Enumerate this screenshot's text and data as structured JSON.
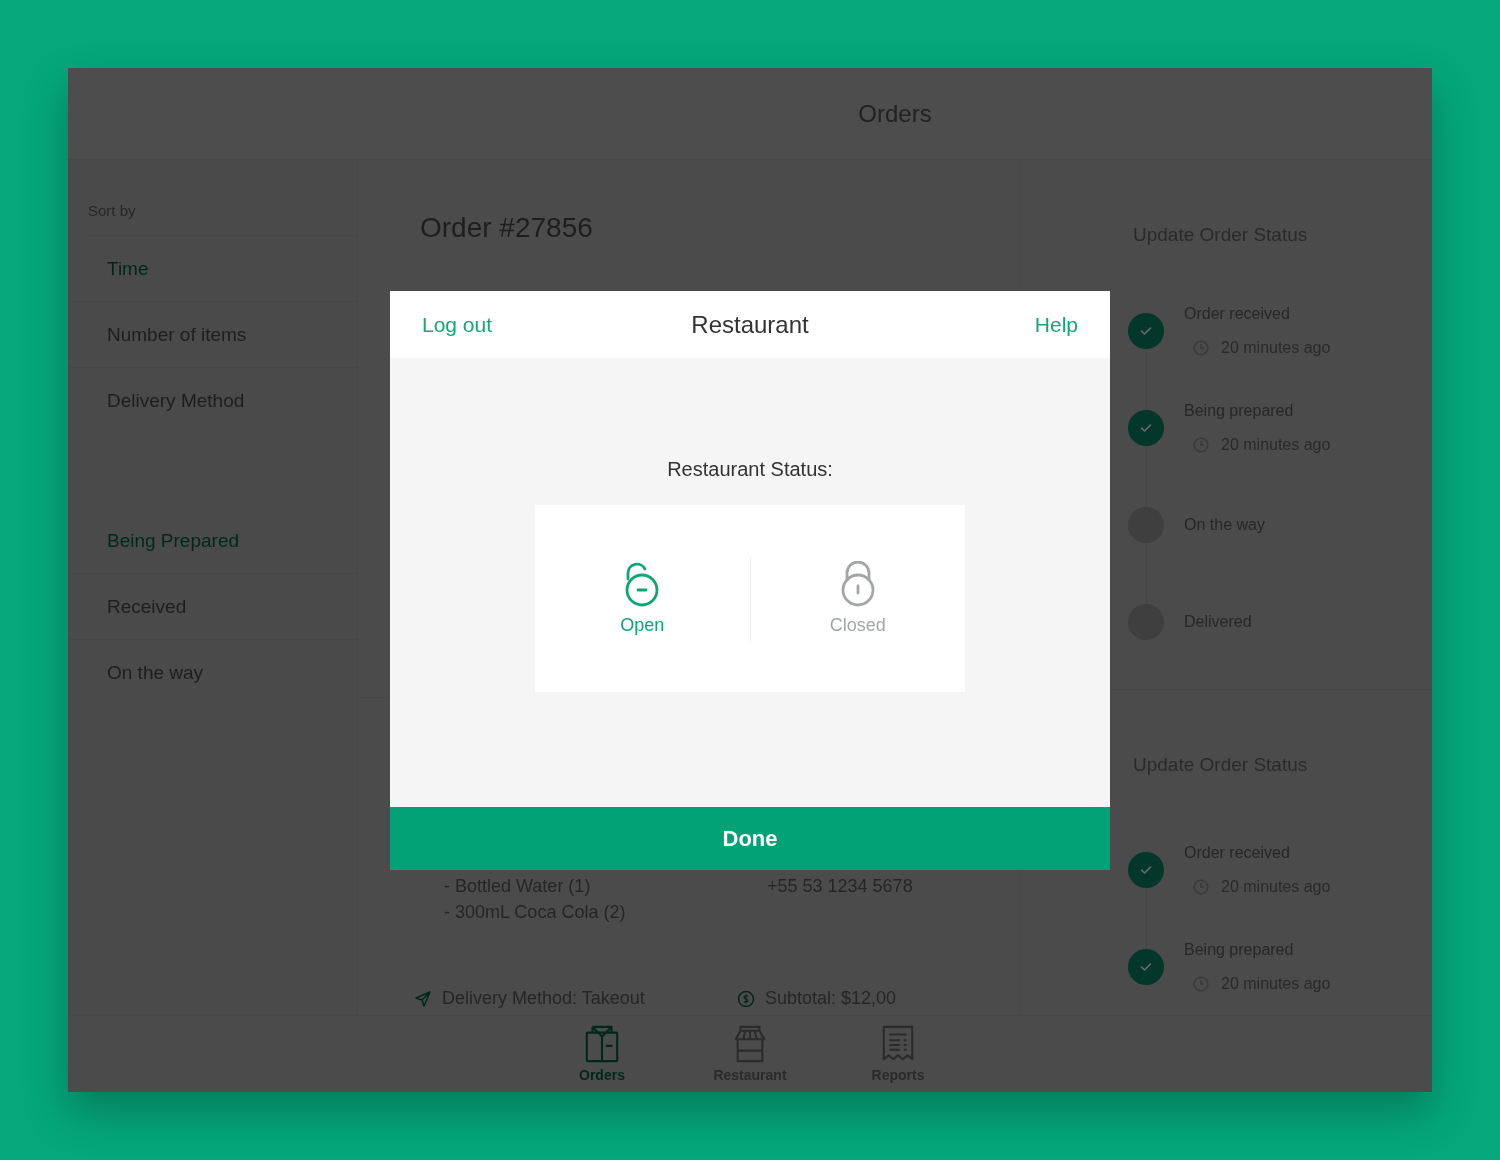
{
  "header": {
    "title": "Orders"
  },
  "sidebar": {
    "sort_label": "Sort by",
    "sort_options": [
      {
        "label": "Time",
        "selected": true
      },
      {
        "label": "Number of items",
        "selected": false
      },
      {
        "label": "Delivery Method",
        "selected": false
      }
    ],
    "status_filters": [
      {
        "label": "Being Prepared",
        "selected": true
      },
      {
        "label": "Received",
        "selected": false
      },
      {
        "label": "On the way",
        "selected": false
      }
    ]
  },
  "orders": [
    {
      "number": "Order #27856"
    },
    {
      "items": [
        "- Bottled Water (1)",
        "- 300mL Coca Cola (2)"
      ],
      "phone": "+55 53 1234 5678",
      "delivery_method": "Delivery Method: Takeout",
      "subtotal": "Subtotal: $12,00"
    }
  ],
  "status_panels": [
    {
      "title": "Update Order Status",
      "steps": [
        {
          "label": "Order received",
          "time": "20 minutes ago",
          "done": true
        },
        {
          "label": "Being prepared",
          "time": "20 minutes ago",
          "done": true
        },
        {
          "label": "On the way",
          "done": false
        },
        {
          "label": "Delivered",
          "done": false
        }
      ]
    },
    {
      "title": "Update Order Status",
      "steps": [
        {
          "label": "Order received",
          "time": "20 minutes ago",
          "done": true
        },
        {
          "label": "Being prepared",
          "time": "20 minutes ago",
          "done": true
        }
      ]
    }
  ],
  "tab_bar": [
    {
      "label": "Orders",
      "kind": "orders",
      "selected": true
    },
    {
      "label": "Restaurant",
      "kind": "restaurant",
      "selected": false
    },
    {
      "label": "Reports",
      "kind": "reports",
      "selected": false
    }
  ],
  "modal": {
    "left_link": "Log out",
    "title": "Restaurant",
    "right_link": "Help",
    "status_label": "Restaurant Status:",
    "options": [
      {
        "label": "Open",
        "kind": "open",
        "selected": true
      },
      {
        "label": "Closed",
        "kind": "closed",
        "selected": false
      }
    ],
    "done_button": "Done"
  }
}
